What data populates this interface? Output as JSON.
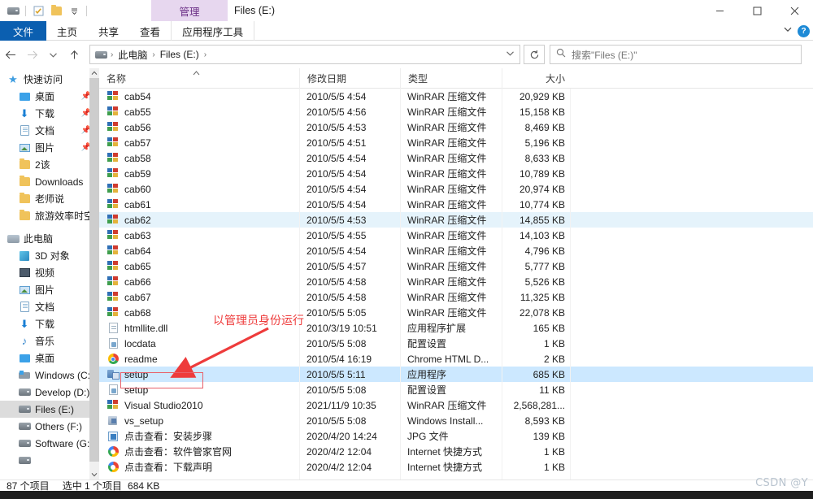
{
  "titlebar": {
    "contextual_tab": "管理",
    "window_title": "Files (E:)",
    "quick_access": [
      "drive-icon",
      "properties-icon",
      "new-folder-icon",
      "customize-dropdown-icon"
    ],
    "minimize": "—",
    "maximize": "□",
    "close": "✕"
  },
  "ribbon": {
    "tabs": [
      {
        "label": "文件",
        "active": false,
        "style": "file"
      },
      {
        "label": "主页",
        "active": false,
        "style": "normal"
      },
      {
        "label": "共享",
        "active": false,
        "style": "normal"
      },
      {
        "label": "查看",
        "active": false,
        "style": "normal"
      },
      {
        "label": "应用程序工具",
        "active": true,
        "style": "contextual"
      }
    ],
    "collapse_icon": "chevron-down-icon",
    "help_label": "?"
  },
  "navbar": {
    "back_icon": "←",
    "forward_icon": "→",
    "recent_icon": "⌄",
    "up_icon": "↑",
    "breadcrumbs": [
      "此电脑",
      "Files (E:)"
    ],
    "breadcrumb_separator": "›",
    "address_dropdown_icon": "⌄",
    "refresh_icon": "↻",
    "search_icon": "search-icon",
    "search_placeholder": "搜索\"Files (E:)\"",
    "search_value": ""
  },
  "sidebar": {
    "groups": [
      {
        "root": {
          "label": "快速访问",
          "icon": "star-icon"
        },
        "items": [
          {
            "label": "桌面",
            "icon": "desktop-icon",
            "pinned": true
          },
          {
            "label": "下载",
            "icon": "download-icon",
            "pinned": true
          },
          {
            "label": "文档",
            "icon": "document-icon",
            "pinned": true
          },
          {
            "label": "图片",
            "icon": "pictures-icon",
            "pinned": true
          },
          {
            "label": "2该",
            "icon": "folder-icon",
            "pinned": false
          },
          {
            "label": "Downloads",
            "icon": "folder-icon",
            "pinned": false
          },
          {
            "label": "老师说",
            "icon": "folder-icon",
            "pinned": false
          },
          {
            "label": "旅游效率时空演化",
            "icon": "folder-icon",
            "pinned": false
          }
        ]
      },
      {
        "root": {
          "label": "此电脑",
          "icon": "this-pc-icon"
        },
        "items": [
          {
            "label": "3D 对象",
            "icon": "3d-objects-icon",
            "pinned": false
          },
          {
            "label": "视频",
            "icon": "videos-icon",
            "pinned": false
          },
          {
            "label": "图片",
            "icon": "pictures-icon",
            "pinned": false
          },
          {
            "label": "文档",
            "icon": "document-icon",
            "pinned": false
          },
          {
            "label": "下载",
            "icon": "download-icon",
            "pinned": false
          },
          {
            "label": "音乐",
            "icon": "music-icon",
            "pinned": false
          },
          {
            "label": "桌面",
            "icon": "desktop-icon",
            "pinned": false
          },
          {
            "label": "Windows (C:)",
            "icon": "system-drive-icon",
            "pinned": false
          },
          {
            "label": "Develop (D:)",
            "icon": "drive-icon",
            "pinned": false
          },
          {
            "label": "Files (E:)",
            "icon": "drive-icon",
            "pinned": false,
            "selected": true
          },
          {
            "label": "Others (F:)",
            "icon": "drive-icon",
            "pinned": false
          },
          {
            "label": "Software (G:)",
            "icon": "drive-icon",
            "pinned": false
          }
        ]
      }
    ],
    "scroll_up_icon": "⌃",
    "scroll_down_icon": "⌄"
  },
  "filelist": {
    "columns": [
      {
        "key": "name",
        "label": "名称",
        "sorted": true,
        "sort_caret": "⌃"
      },
      {
        "key": "date",
        "label": "修改日期"
      },
      {
        "key": "type",
        "label": "类型"
      },
      {
        "key": "size",
        "label": "大小"
      }
    ],
    "rows": [
      {
        "name": "cab54",
        "date": "2010/5/5 4:54",
        "type": "WinRAR 压缩文件",
        "size": "20,929 KB",
        "icon": "winrar-icon",
        "state": ""
      },
      {
        "name": "cab55",
        "date": "2010/5/5 4:56",
        "type": "WinRAR 压缩文件",
        "size": "15,158 KB",
        "icon": "winrar-icon",
        "state": ""
      },
      {
        "name": "cab56",
        "date": "2010/5/5 4:53",
        "type": "WinRAR 压缩文件",
        "size": "8,469 KB",
        "icon": "winrar-icon",
        "state": ""
      },
      {
        "name": "cab57",
        "date": "2010/5/5 4:51",
        "type": "WinRAR 压缩文件",
        "size": "5,196 KB",
        "icon": "winrar-icon",
        "state": ""
      },
      {
        "name": "cab58",
        "date": "2010/5/5 4:54",
        "type": "WinRAR 压缩文件",
        "size": "8,633 KB",
        "icon": "winrar-icon",
        "state": ""
      },
      {
        "name": "cab59",
        "date": "2010/5/5 4:54",
        "type": "WinRAR 压缩文件",
        "size": "10,789 KB",
        "icon": "winrar-icon",
        "state": ""
      },
      {
        "name": "cab60",
        "date": "2010/5/5 4:54",
        "type": "WinRAR 压缩文件",
        "size": "20,974 KB",
        "icon": "winrar-icon",
        "state": ""
      },
      {
        "name": "cab61",
        "date": "2010/5/5 4:54",
        "type": "WinRAR 压缩文件",
        "size": "10,774 KB",
        "icon": "winrar-icon",
        "state": ""
      },
      {
        "name": "cab62",
        "date": "2010/5/5 4:53",
        "type": "WinRAR 压缩文件",
        "size": "14,855 KB",
        "icon": "winrar-icon",
        "state": "hover"
      },
      {
        "name": "cab63",
        "date": "2010/5/5 4:55",
        "type": "WinRAR 压缩文件",
        "size": "14,103 KB",
        "icon": "winrar-icon",
        "state": ""
      },
      {
        "name": "cab64",
        "date": "2010/5/5 4:54",
        "type": "WinRAR 压缩文件",
        "size": "4,796 KB",
        "icon": "winrar-icon",
        "state": ""
      },
      {
        "name": "cab65",
        "date": "2010/5/5 4:57",
        "type": "WinRAR 压缩文件",
        "size": "5,777 KB",
        "icon": "winrar-icon",
        "state": ""
      },
      {
        "name": "cab66",
        "date": "2010/5/5 4:58",
        "type": "WinRAR 压缩文件",
        "size": "5,526 KB",
        "icon": "winrar-icon",
        "state": ""
      },
      {
        "name": "cab67",
        "date": "2010/5/5 4:58",
        "type": "WinRAR 压缩文件",
        "size": "11,325 KB",
        "icon": "winrar-icon",
        "state": ""
      },
      {
        "name": "cab68",
        "date": "2010/5/5 5:05",
        "type": "WinRAR 压缩文件",
        "size": "22,078 KB",
        "icon": "winrar-icon",
        "state": ""
      },
      {
        "name": "htmllite.dll",
        "date": "2010/3/19 10:51",
        "type": "应用程序扩展",
        "size": "165 KB",
        "icon": "dll-icon",
        "state": ""
      },
      {
        "name": "locdata",
        "date": "2010/5/5 5:08",
        "type": "配置设置",
        "size": "1 KB",
        "icon": "config-icon",
        "state": ""
      },
      {
        "name": "readme",
        "date": "2010/5/4 16:19",
        "type": "Chrome HTML D...",
        "size": "2 KB",
        "icon": "chrome-icon",
        "state": ""
      },
      {
        "name": "setup",
        "date": "2010/5/5 5:11",
        "type": "应用程序",
        "size": "685 KB",
        "icon": "exe-icon",
        "state": "selected"
      },
      {
        "name": "setup",
        "date": "2010/5/5 5:08",
        "type": "配置设置",
        "size": "11 KB",
        "icon": "config-icon",
        "state": ""
      },
      {
        "name": "Visual Studio2010",
        "date": "2021/11/9 10:35",
        "type": "WinRAR 压缩文件",
        "size": "2,568,281...",
        "icon": "winrar-icon",
        "state": ""
      },
      {
        "name": "vs_setup",
        "date": "2010/5/5 5:08",
        "type": "Windows Install...",
        "size": "8,593 KB",
        "icon": "msi-icon",
        "state": ""
      },
      {
        "name": "点击查看：安装步骤",
        "date": "2020/4/20 14:24",
        "type": "JPG 文件",
        "size": "139 KB",
        "icon": "jpg-icon",
        "state": ""
      },
      {
        "name": "点击查看：软件管家官网",
        "date": "2020/4/2 12:04",
        "type": "Internet 快捷方式",
        "size": "1 KB",
        "icon": "internet-shortcut-icon",
        "state": ""
      },
      {
        "name": "点击查看：下载声明",
        "date": "2020/4/2 12:04",
        "type": "Internet 快捷方式",
        "size": "1 KB",
        "icon": "internet-shortcut-icon",
        "state": ""
      }
    ]
  },
  "statusbar": {
    "item_count": "87 个项目",
    "selection": "选中 1 个项目",
    "selection_size": "684 KB"
  },
  "annotations": {
    "run_as_admin_text": "以管理员身份运行",
    "arrow_color": "#ee3b3b",
    "highlight_box_color": "#e8606a"
  },
  "watermark": {
    "text": "CSDN @Y"
  },
  "colors": {
    "file_tab_blue": "#0b5fb0",
    "contextual_tab_purple": "#e7d7ef",
    "contextual_tab_text": "#6b2f86",
    "selected_row_blue": "#cce8ff",
    "hover_row_blue": "#e5f3fb",
    "sidebar_selected_gray": "#dcdcdc",
    "annotation_red": "#ee3b3b",
    "help_blue": "#1e8ad6"
  }
}
